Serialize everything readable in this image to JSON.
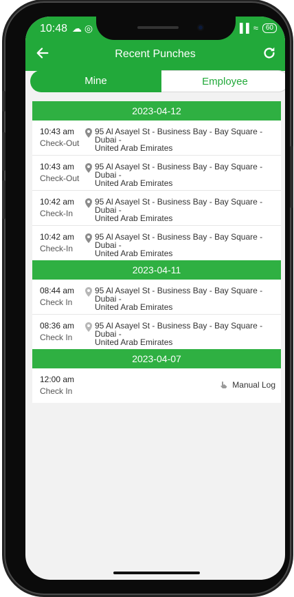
{
  "status": {
    "time": "10:48",
    "left_icons": "☁ ◎",
    "signal": "▐▐",
    "wifi": "≈",
    "battery": "60"
  },
  "header": {
    "title": "Recent Punches"
  },
  "tabs": {
    "mine": "Mine",
    "employee": "Employee"
  },
  "groups": [
    {
      "date": "2023-04-12",
      "rows": [
        {
          "time": "10:43 am",
          "type": "Check-Out",
          "addr1": "95 Al Asayel St - Business Bay - Bay Square - Dubai -",
          "addr2": "United Arab Emirates"
        },
        {
          "time": "10:43 am",
          "type": "Check-Out",
          "addr1": "95 Al Asayel St - Business Bay - Bay Square - Dubai -",
          "addr2": "United Arab Emirates"
        },
        {
          "time": "10:42 am",
          "type": "Check-In",
          "addr1": "95 Al Asayel St - Business Bay - Bay Square - Dubai -",
          "addr2": "United Arab Emirates"
        },
        {
          "time": "10:42 am",
          "type": "Check-In",
          "addr1": "95 Al Asayel St - Business Bay - Bay Square - Dubai -",
          "addr2": "United Arab Emirates"
        }
      ]
    },
    {
      "date": "2023-04-11",
      "rows": [
        {
          "time": "08:44 am",
          "type": "Check In",
          "addr1": "95 Al Asayel St - Business Bay - Bay Square - Dubai -",
          "addr2": "United Arab Emirates"
        },
        {
          "time": "08:36 am",
          "type": "Check In",
          "addr1": "95 Al Asayel St - Business Bay - Bay Square - Dubai -",
          "addr2": "United Arab Emirates"
        }
      ]
    },
    {
      "date": "2023-04-07",
      "rows": [
        {
          "time": "12:00 am",
          "type": "Check In",
          "manual": "Manual Log"
        }
      ]
    }
  ],
  "colors": {
    "primary": "#22a93a",
    "pin_dark": "#8c8c8c",
    "pin_light": "#b7b7b7"
  }
}
